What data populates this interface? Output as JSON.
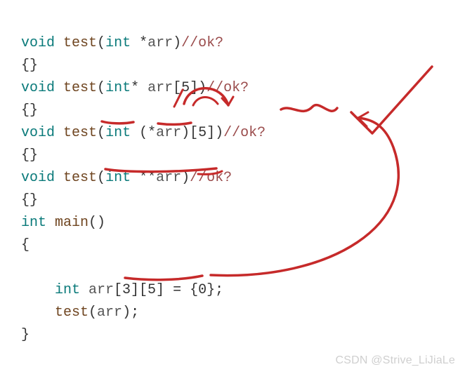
{
  "code": {
    "line1": {
      "kw1": "void",
      "fn": "test",
      "op1": "(",
      "kw2": "int",
      "ptr": " *",
      "id": "arr",
      "op2": ")",
      "cm": "//ok?"
    },
    "line2": "{}",
    "line3": {
      "kw1": "void",
      "fn": "test",
      "op1": "(",
      "kw2": "int",
      "ptr": "* ",
      "id": "arr",
      "sz": "[5]",
      "op2": ")",
      "cm": "//ok?"
    },
    "line4": "{}",
    "line5": {
      "kw1": "void",
      "fn": "test",
      "op1": "(",
      "kw2": "int",
      "op_a": " (*",
      "id": "arr",
      "op_b": ")",
      "sz": "[5]",
      "op2": ")",
      "cm": "//ok?"
    },
    "line6": "{}",
    "line7": {
      "kw1": "void",
      "fn": "test",
      "op1": "(",
      "kw2": "int",
      "ptr": " **",
      "id": "arr",
      "op2": ")",
      "cm": "//ok?"
    },
    "line8": "{}",
    "line9": {
      "kw": "int",
      "fn": "main",
      "op": "()"
    },
    "line10": "{",
    "line12": {
      "indent": "    ",
      "kw": "int",
      "id": " arr",
      "sz": "[3][5]",
      "assign": " = {0};"
    },
    "line13": {
      "indent": "    ",
      "fn": "test",
      "op1": "(",
      "id": "arr",
      "op2": ");"
    },
    "line14": "}"
  },
  "watermark": "CSDN @Strive_LiJiaLe",
  "annotation_colors": {
    "ink": "#c62a2a"
  }
}
